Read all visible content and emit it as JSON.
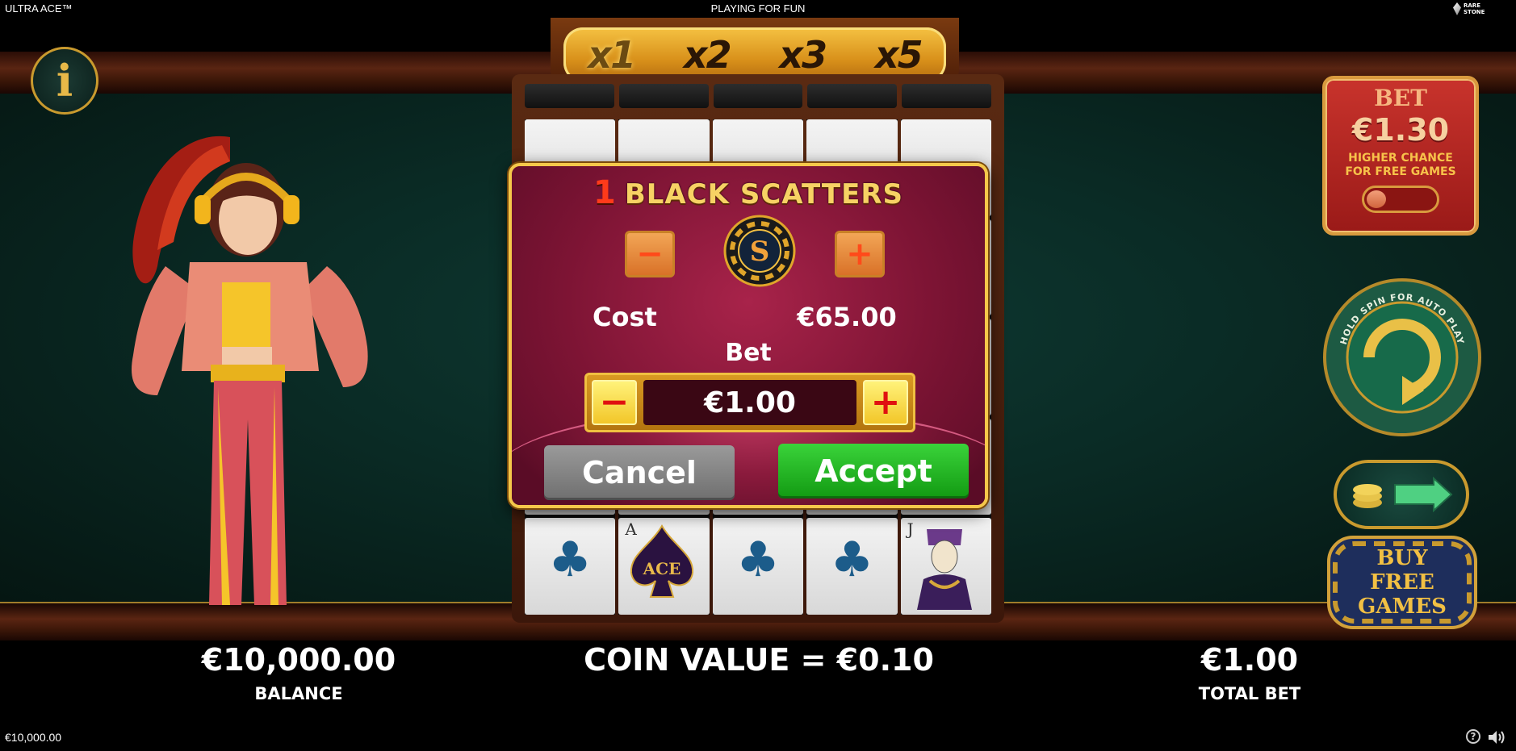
{
  "topbar": {
    "game_name": "ULTRA ACE™",
    "mode": "PLAYING FOR FUN",
    "brand_line1": "RARE",
    "brand_line2": "STONE"
  },
  "info": {
    "icon": "info-icon",
    "label": "i"
  },
  "multipliers": {
    "items": [
      "x1",
      "x2",
      "x3",
      "x5"
    ],
    "active_index": 0
  },
  "dialog": {
    "scatter_count": "1",
    "title": "BLACK SCATTERS",
    "scatter_minus": "−",
    "scatter_plus": "+",
    "chip_icon": "scatter-chip-icon",
    "chip_letter": "S",
    "cost_label": "Cost",
    "cost_value": "€65.00",
    "bet_label": "Bet",
    "bet_minus": "−",
    "bet_plus": "+",
    "bet_value": "€1.00",
    "cancel_label": "Cancel",
    "accept_label": "Accept"
  },
  "bet_boost": {
    "label": "BET",
    "amount": "€1.30",
    "desc_line1": "HIGHER CHANCE",
    "desc_line2": "FOR FREE GAMES",
    "enabled": false
  },
  "spin": {
    "hint": "HOLD SPIN FOR AUTO PLAY",
    "icon": "spin-arrow-icon"
  },
  "coin_toggle": {
    "icons": [
      "coin-stack-icon",
      "arrow-right-icon"
    ]
  },
  "buy_free_games": {
    "line1": "BUY",
    "line2": "FREE",
    "line3": "GAMES"
  },
  "reels": {
    "visible_symbols": [
      "club",
      "ace",
      "club",
      "club",
      "jack"
    ],
    "ace_letter": "A",
    "ace_label": "ACE",
    "jack_letter": "J"
  },
  "bottom": {
    "balance_value": "€10,000.00",
    "balance_label": "BALANCE",
    "coin_value_text": "COIN VALUE = €0.10",
    "total_bet_value": "€1.00",
    "total_bet_label": "TOTAL BET"
  },
  "footer": {
    "balance": "€10,000.00",
    "help_label": "?"
  },
  "colors": {
    "felt": "#0a2b25",
    "dialog": "#7d1434",
    "accept": "#1fb51f",
    "cancel": "#8a8a8a",
    "gold": "#f5c84a"
  }
}
